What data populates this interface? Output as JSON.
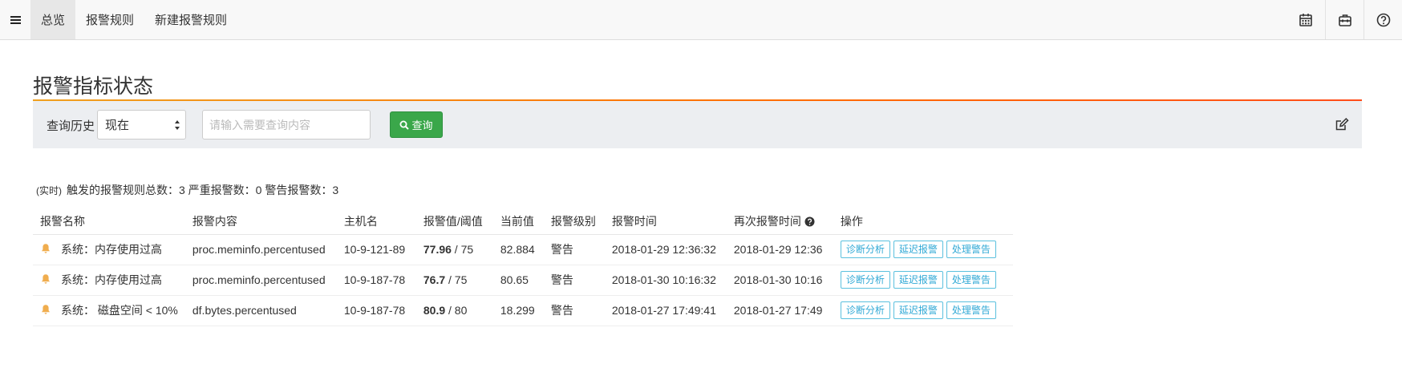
{
  "nav": {
    "tabs": [
      {
        "label": "总览",
        "active": true
      },
      {
        "label": "报警规则",
        "active": false
      },
      {
        "label": "新建报警规则",
        "active": false
      }
    ],
    "right_icons": [
      "calendar-icon",
      "toolbox-icon",
      "help-icon"
    ]
  },
  "page": {
    "title": "报警指标状态"
  },
  "query": {
    "history_label": "查询历史",
    "select_value": "现在",
    "input_placeholder": "请输入需要查询内容",
    "input_value": "",
    "search_button": "查询"
  },
  "summary": {
    "live_tag": "(实时)",
    "text": "触发的报警规则总数：3 严重报警数：0 警告报警数：3"
  },
  "table": {
    "headers": [
      "报警名称",
      "报警内容",
      "主机名",
      "报警值/阈值",
      "当前值",
      "报警级别",
      "报警时间",
      "再次报警时间",
      "操作"
    ],
    "rows": [
      {
        "name": "系统：内存使用过高",
        "content": "proc.meminfo.percentused",
        "host": "10-9-121-89",
        "value": "77.96",
        "threshold": " / 75",
        "current": "82.884",
        "level": "警告",
        "time": "2018-01-29 12:36:32",
        "again": "2018-01-29 12:36"
      },
      {
        "name": "系统：内存使用过高",
        "content": "proc.meminfo.percentused",
        "host": "10-9-187-78",
        "value": "76.7",
        "threshold": " / 75",
        "current": "80.65",
        "level": "警告",
        "time": "2018-01-30 10:16:32",
        "again": "2018-01-30 10:16"
      },
      {
        "name": "系统： 磁盘空间 < 10%",
        "content": "df.bytes.percentused",
        "host": "10-9-187-78",
        "value": "80.9",
        "threshold": " / 80",
        "current": "18.299",
        "level": "警告",
        "time": "2018-01-27 17:49:41",
        "again": "2018-01-27 17:49"
      }
    ],
    "actions": [
      "诊断分析",
      "延迟报警",
      "处理警告"
    ]
  },
  "colors": {
    "accent_green": "#3aa74a",
    "action_blue": "#31a9d6",
    "bell_yellow": "#f0ad4e",
    "title_rule": "#ff6a00"
  }
}
